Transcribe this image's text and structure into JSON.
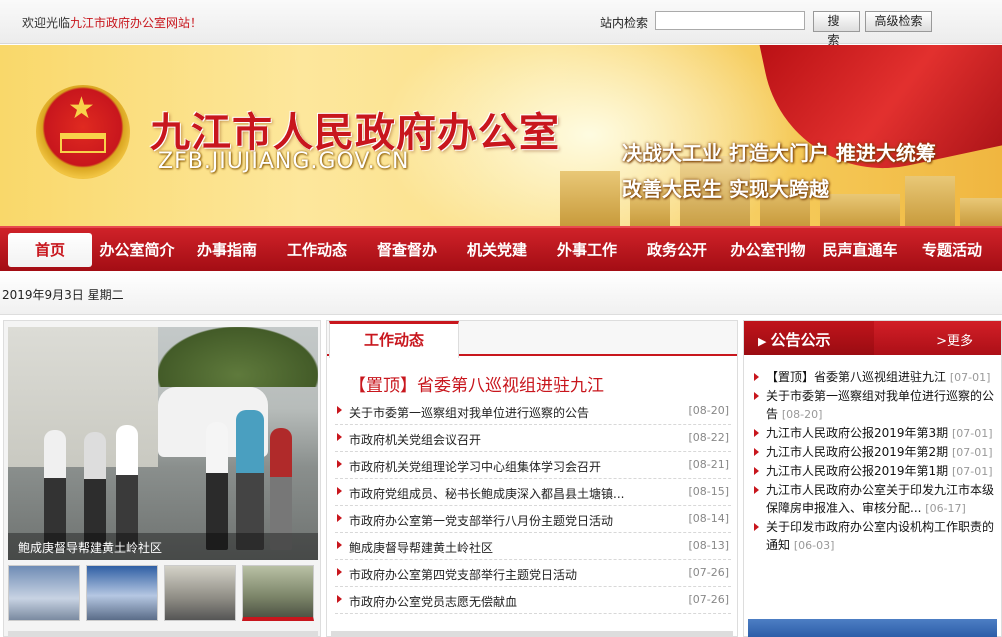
{
  "topbar": {
    "welcome_prefix": "欢迎光临",
    "welcome_site": "九江市政府办公室网站",
    "welcome_suffix": "！",
    "search_label": "站内检索",
    "search_value": "",
    "search_button": "搜 索",
    "advanced_button": "高级检索"
  },
  "banner": {
    "title": "九江市人民政府办公室",
    "domain": "ZFB.JIUJIANG.GOV.CN",
    "slogan_line1": "决战大工业 打造大门户 推进大统筹",
    "slogan_line2": "改善大民生 实现大跨越"
  },
  "nav": {
    "items": [
      "首页",
      "办公室简介",
      "办事指南",
      "工作动态",
      "督查督办",
      "机关党建",
      "外事工作",
      "政务公开",
      "办公室刊物",
      "民声直通车",
      "专题活动"
    ]
  },
  "date": {
    "text": "2019年9月3日  星期二"
  },
  "photo": {
    "caption": "鲍成庚督导帮建黄土岭社区"
  },
  "news": {
    "tab_label": "工作动态",
    "headline": "【置顶】省委第八巡视组进驻九江",
    "items": [
      {
        "title": "关于市委第一巡察组对我单位进行巡察的公告",
        "date": "[08-20]"
      },
      {
        "title": "市政府机关党组会议召开",
        "date": "[08-22]"
      },
      {
        "title": "市政府机关党组理论学习中心组集体学习会召开",
        "date": "[08-21]"
      },
      {
        "title": "市政府党组成员、秘书长鲍成庚深入都昌县土塘镇...",
        "date": "[08-15]"
      },
      {
        "title": "市政府办公室第一党支部举行八月份主题党日活动",
        "date": "[08-14]"
      },
      {
        "title": "鲍成庚督导帮建黄土岭社区",
        "date": "[08-13]"
      },
      {
        "title": "市政府办公室第四党支部举行主题党日活动",
        "date": "[07-26]"
      },
      {
        "title": "市政府办公室党员志愿无偿献血",
        "date": "[07-26]"
      }
    ]
  },
  "notices": {
    "tab_label": "公告公示",
    "more": ">更多",
    "items": [
      {
        "title": "【置顶】省委第八巡视组进驻九江",
        "date": "[07-01]"
      },
      {
        "title": "关于市委第一巡察组对我单位进行巡察的公告",
        "date": "[08-20]"
      },
      {
        "title": "九江市人民政府公报2019年第3期",
        "date": "[07-01]"
      },
      {
        "title": "九江市人民政府公报2019年第2期",
        "date": "[07-01]"
      },
      {
        "title": "九江市人民政府公报2019年第1期",
        "date": "[07-01]"
      },
      {
        "title": "九江市人民政府办公室关于印发九江市本级保障房申报准入、审核分配...",
        "date": "[06-17]"
      },
      {
        "title": "关于印发市政府办公室内设机构工作职责的通知",
        "date": "[06-03]"
      }
    ]
  },
  "colors": {
    "accent": "#c8161d",
    "banner_gold": "#f9d86a"
  },
  "icons": {
    "emblem": "national-emblem-icon",
    "bullet": "triangle-right-icon"
  }
}
